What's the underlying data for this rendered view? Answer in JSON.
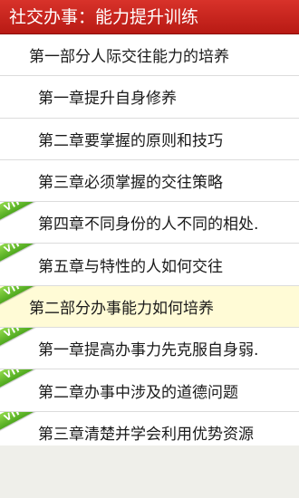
{
  "header": {
    "title": "社交办事：能力提升训练"
  },
  "list": {
    "items": [
      {
        "text": "第一部分人际交往能力的培养",
        "kind": "part",
        "vip": false,
        "highlight": false
      },
      {
        "text": "第一章提升自身修养",
        "kind": "chapter",
        "vip": false,
        "highlight": false
      },
      {
        "text": "第二章要掌握的原则和技巧",
        "kind": "chapter",
        "vip": false,
        "highlight": false
      },
      {
        "text": "第三章必须掌握的交往策略",
        "kind": "chapter",
        "vip": false,
        "highlight": false
      },
      {
        "text": "第四章不同身份的人不同的相处.",
        "kind": "chapter",
        "vip": true,
        "highlight": false
      },
      {
        "text": "第五章与特性的人如何交往",
        "kind": "chapter",
        "vip": true,
        "highlight": false
      },
      {
        "text": "第二部分办事能力如何培养",
        "kind": "part",
        "vip": true,
        "highlight": true
      },
      {
        "text": "第一章提高办事力先克服自身弱.",
        "kind": "chapter",
        "vip": true,
        "highlight": false
      },
      {
        "text": "第二章办事中涉及的道德问题",
        "kind": "chapter",
        "vip": true,
        "highlight": false
      },
      {
        "text": "第三章清楚并学会利用优势资源",
        "kind": "chapter",
        "vip": true,
        "highlight": false
      }
    ],
    "vip_label": "VIP"
  },
  "colors": {
    "title_bar": "#c9241d",
    "vip_ribbon": "#6cc02f",
    "highlight_row": "#fffbd6"
  }
}
